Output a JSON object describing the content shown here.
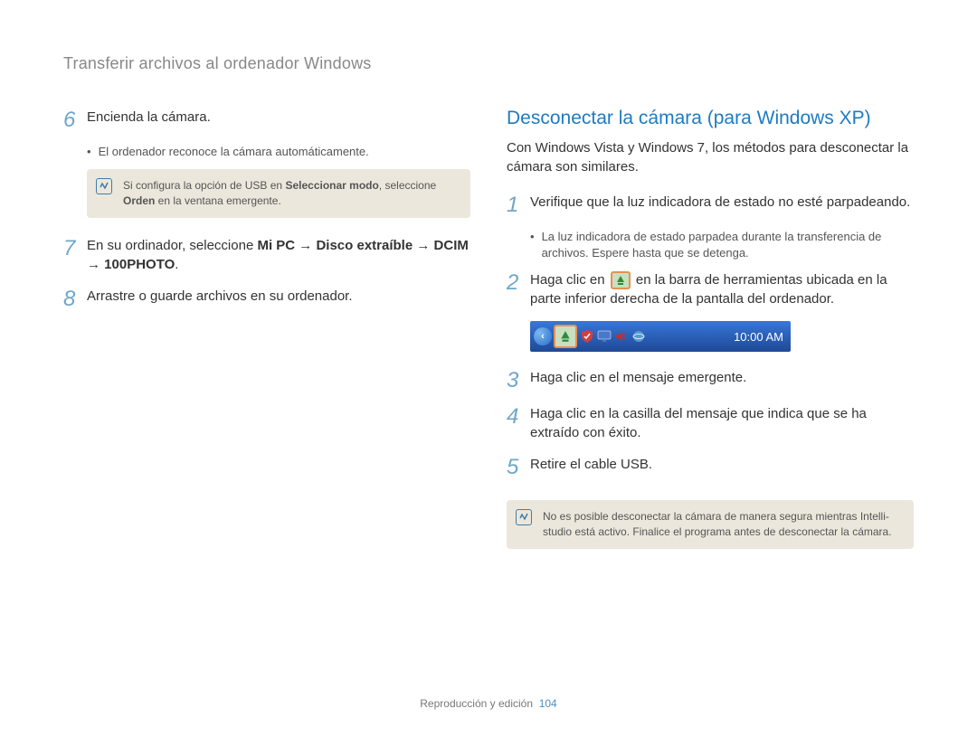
{
  "header": {
    "title": "Transferir archivos al ordenador Windows"
  },
  "left": {
    "steps": [
      {
        "num": "6",
        "text": "Encienda la cámara.",
        "bullet": "El ordenador reconoce la cámara automáticamente.",
        "note": {
          "pre": "Si configura la opción de USB en ",
          "b1": "Seleccionar modo",
          "mid": ", seleccione ",
          "b2": "Orden",
          "post": " en la ventana emergente."
        }
      },
      {
        "num": "7",
        "pre": "En su ordinador, seleccione ",
        "b1": "Mi PC",
        "arrow1": " → ",
        "b2": "Disco extraíble",
        "arrow2": " → ",
        "b3": "DCIM",
        "arrow3": " → ",
        "b4": "100PHOTO",
        "post": "."
      },
      {
        "num": "8",
        "text": "Arrastre o guarde archivos en su ordenador."
      }
    ]
  },
  "right": {
    "heading": "Desconectar la cámara (para Windows XP)",
    "intro": "Con Windows Vista y Windows 7, los métodos para desconectar la cámara son similares.",
    "steps": [
      {
        "num": "1",
        "text": "Verifique que la luz indicadora de estado no esté parpadeando.",
        "bullet": "La luz indicadora de estado parpadea durante la transferencia de archivos. Espere hasta que se detenga."
      },
      {
        "num": "2",
        "pre": "Haga clic en ",
        "post": " en la barra de herramientas ubicada en la parte inferior derecha de la pantalla del ordenador."
      },
      {
        "num": "3",
        "text": "Haga clic en el mensaje emergente."
      },
      {
        "num": "4",
        "text": "Haga clic en la casilla del mensaje que indica que se ha extraído con éxito."
      },
      {
        "num": "5",
        "text": "Retire el cable USB."
      }
    ],
    "taskbar_time": "10:00 AM",
    "note": "No es posible desconectar la cámara de manera segura mientras Intelli-studio está activo. Finalice el programa antes de desconectar la cámara."
  },
  "footer": {
    "section": "Reproducción y edición",
    "page": "104"
  }
}
